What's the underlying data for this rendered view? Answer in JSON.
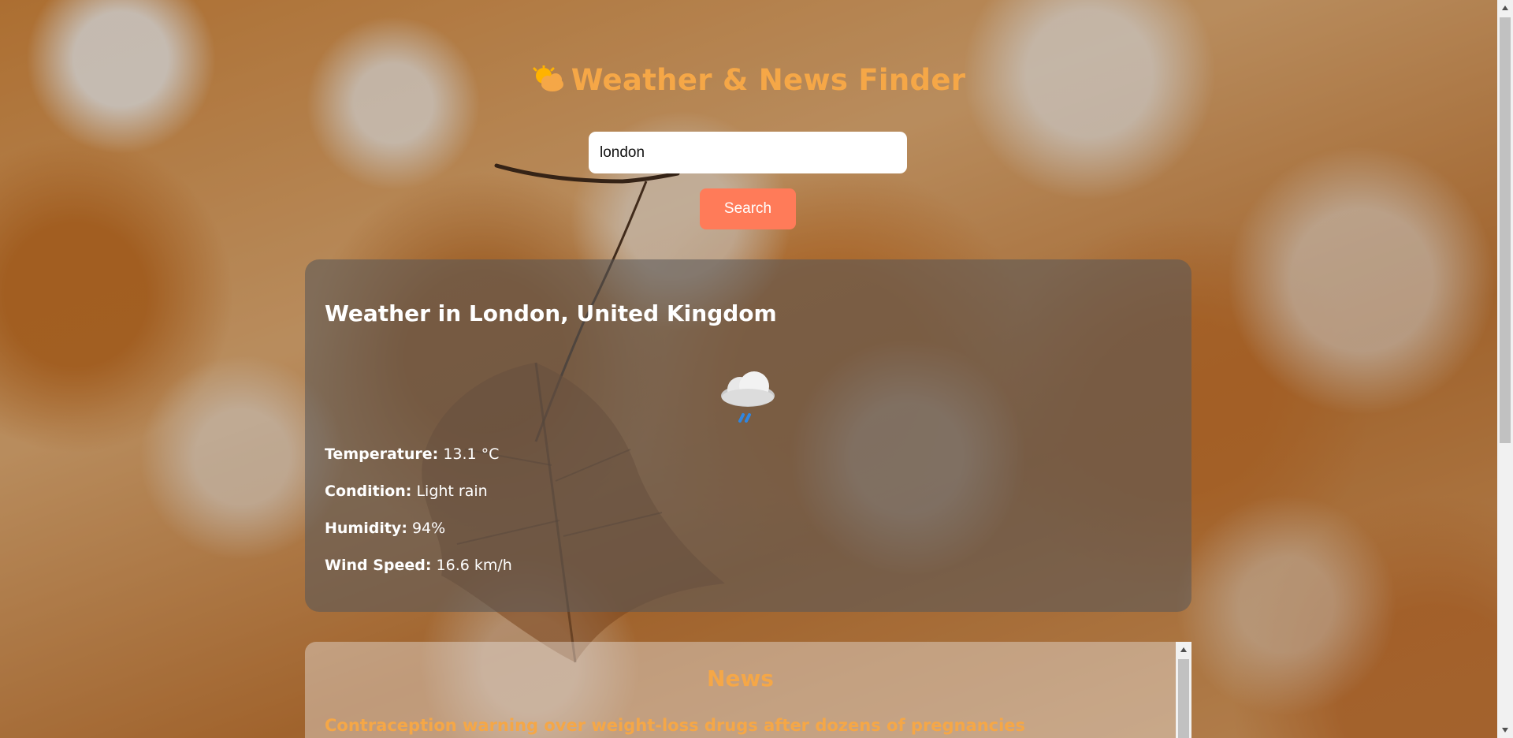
{
  "app": {
    "title": "Weather & News Finder",
    "title_icon": "sun-behind-cloud-icon"
  },
  "search": {
    "value": "london",
    "placeholder": "",
    "button_label": "Search"
  },
  "weather": {
    "heading": "Weather in London, United Kingdom",
    "icon": "cloud-with-rain-icon",
    "temperature_label": "Temperature:",
    "temperature_value": "13.1 °C",
    "condition_label": "Condition:",
    "condition_value": "Light rain",
    "humidity_label": "Humidity:",
    "humidity_value": "94%",
    "wind_label": "Wind Speed:",
    "wind_value": "16.6 km/h"
  },
  "news": {
    "heading": "News",
    "items": [
      {
        "title": "Contraception warning over weight-loss drugs after dozens of pregnancies"
      }
    ]
  },
  "colors": {
    "accent": "#f5a747",
    "button": "#ff7b59",
    "text_light": "#ffffff"
  }
}
